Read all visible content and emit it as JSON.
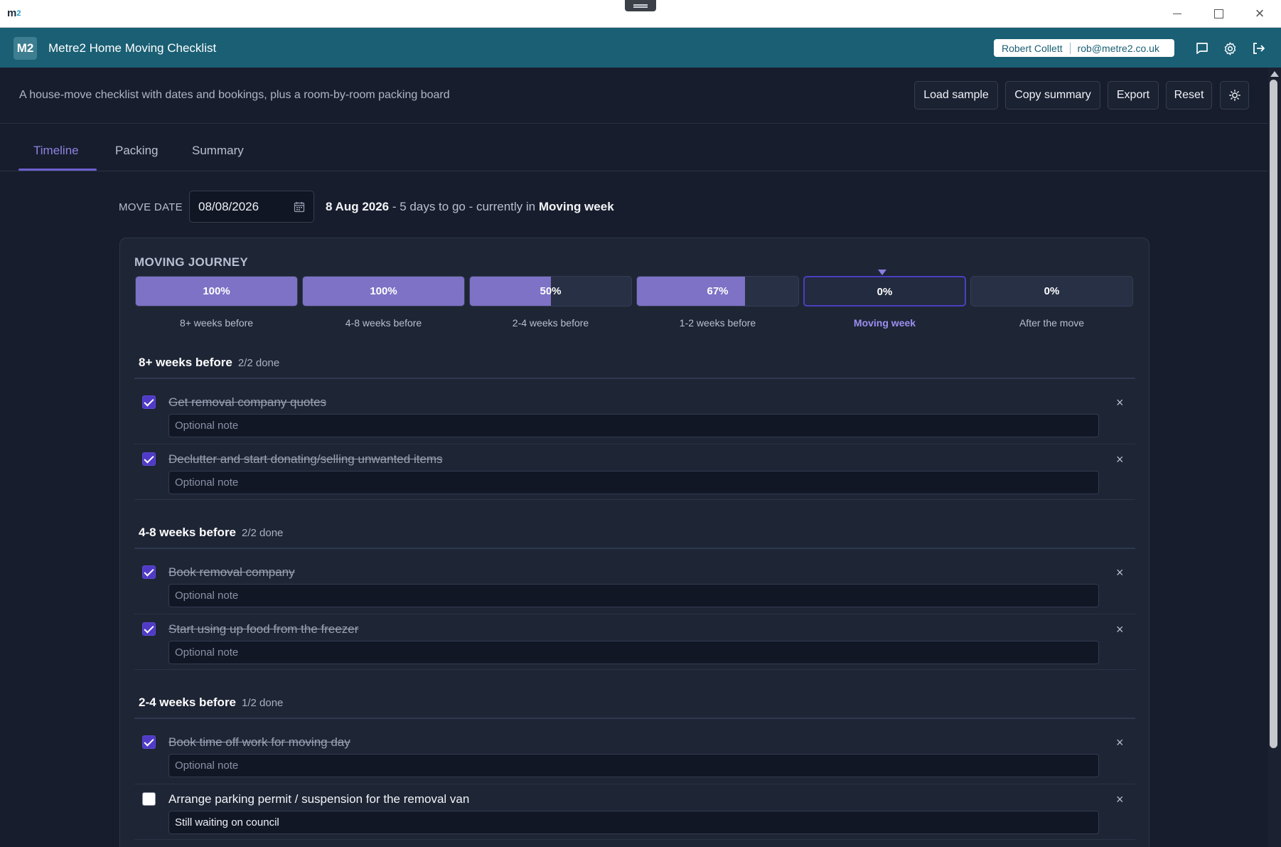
{
  "os": {
    "logo": "m",
    "logo_sub": "2"
  },
  "app": {
    "badge": "M2",
    "title": "Metre2 Home Moving Checklist",
    "user_name": "Robert Collett",
    "user_email": "rob@metre2.co.uk"
  },
  "toolbar": {
    "subtitle": "A house-move checklist with dates and bookings, plus a room-by-room packing board",
    "load_sample": "Load sample",
    "copy_summary": "Copy summary",
    "export": "Export",
    "reset": "Reset"
  },
  "tabs": [
    {
      "label": "Timeline",
      "active": true
    },
    {
      "label": "Packing",
      "active": false
    },
    {
      "label": "Summary",
      "active": false
    }
  ],
  "move": {
    "label": "MOVE DATE",
    "date_value": "08/08/2026",
    "date_long": "8 Aug 2026",
    "days_text": " - 5 days to go - currently in ",
    "current_stage": "Moving week"
  },
  "journey": {
    "title": "MOVING JOURNEY",
    "stages": [
      {
        "label": "8+ weeks before",
        "progress": 100,
        "pct": "100%"
      },
      {
        "label": "4-8 weeks before",
        "progress": 100,
        "pct": "100%"
      },
      {
        "label": "2-4 weeks before",
        "progress": 50,
        "pct": "50%"
      },
      {
        "label": "1-2 weeks before",
        "progress": 67,
        "pct": "67%"
      },
      {
        "label": "Moving week",
        "progress": 0,
        "pct": "0%",
        "current": true
      },
      {
        "label": "After the move",
        "progress": 0,
        "pct": "0%"
      }
    ]
  },
  "groups": [
    {
      "title": "8+ weeks before",
      "count": "2/2 done",
      "tasks": [
        {
          "label": "Get removal company quotes",
          "done": true,
          "note": "",
          "placeholder": "Optional note"
        },
        {
          "label": "Declutter and start donating/selling unwanted items",
          "done": true,
          "note": "",
          "placeholder": "Optional note"
        }
      ]
    },
    {
      "title": "4-8 weeks before",
      "count": "2/2 done",
      "tasks": [
        {
          "label": "Book removal company",
          "done": true,
          "note": "",
          "placeholder": "Optional note"
        },
        {
          "label": "Start using up food from the freezer",
          "done": true,
          "note": "",
          "placeholder": "Optional note"
        }
      ]
    },
    {
      "title": "2-4 weeks before",
      "count": "1/2 done",
      "tasks": [
        {
          "label": "Book time off work for moving day",
          "done": true,
          "note": "",
          "placeholder": "Optional note"
        },
        {
          "label": "Arrange parking permit / suspension for the removal van",
          "done": false,
          "note": "Still waiting on council",
          "placeholder": "Optional note"
        }
      ]
    }
  ],
  "icons": {
    "chat": "chat-bubble-icon",
    "settings": "gear-icon",
    "logout": "logout-icon",
    "theme": "sun-icon",
    "calendar": "calendar-icon",
    "remove": "close-icon"
  },
  "colors": {
    "header": "#1a5f74",
    "accent": "#6f5fd0",
    "progress": "#7d72c6",
    "background": "#171d2c"
  }
}
